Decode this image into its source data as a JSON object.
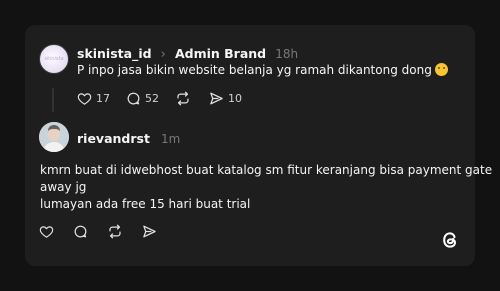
{
  "post": {
    "username": "skinista_id",
    "separator": "›",
    "reposter": "Admin Brand",
    "time": "18h",
    "text": "P inpo jasa bikin website belanja yg ramah dikantong dong",
    "emoji_icon": "hugging-face-emoji",
    "likes": "17",
    "replies": "52",
    "shares": "10"
  },
  "reply": {
    "username": "rievandrst",
    "time": "1m",
    "text_line1": "kmrn buat di idwebhost buat katalog sm fitur keranjang bisa payment gate",
    "text_line2": "away jg",
    "text_line3": "lumayan ada free 15 hari buat trial"
  },
  "icons": {
    "like": "heart-icon",
    "reply": "comment-icon",
    "repost": "repost-icon",
    "share": "send-icon",
    "brand": "threads-logo-icon"
  },
  "colors": {
    "background": "#121212",
    "card": "#1e1e1e",
    "text": "#f3f5f7",
    "muted": "#777777"
  }
}
